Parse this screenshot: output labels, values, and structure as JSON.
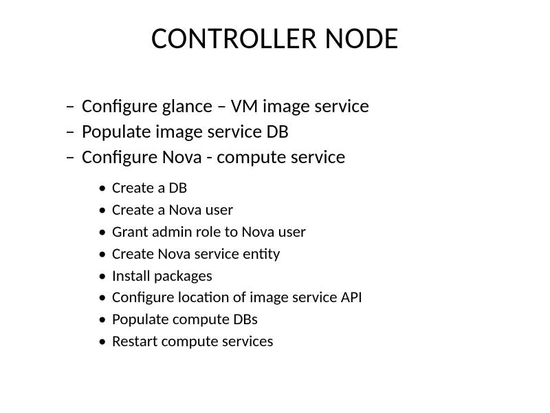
{
  "title": "CONTROLLER NODE",
  "level1": [
    "Configure glance – VM image service",
    "Populate image service DB",
    "Configure Nova - compute service"
  ],
  "level2": [
    "Create a DB",
    "Create a Nova user",
    "Grant admin role to Nova user",
    "Create Nova service entity",
    "Install packages",
    "Configure location of image service API",
    "Populate compute DBs",
    "Restart compute services"
  ]
}
